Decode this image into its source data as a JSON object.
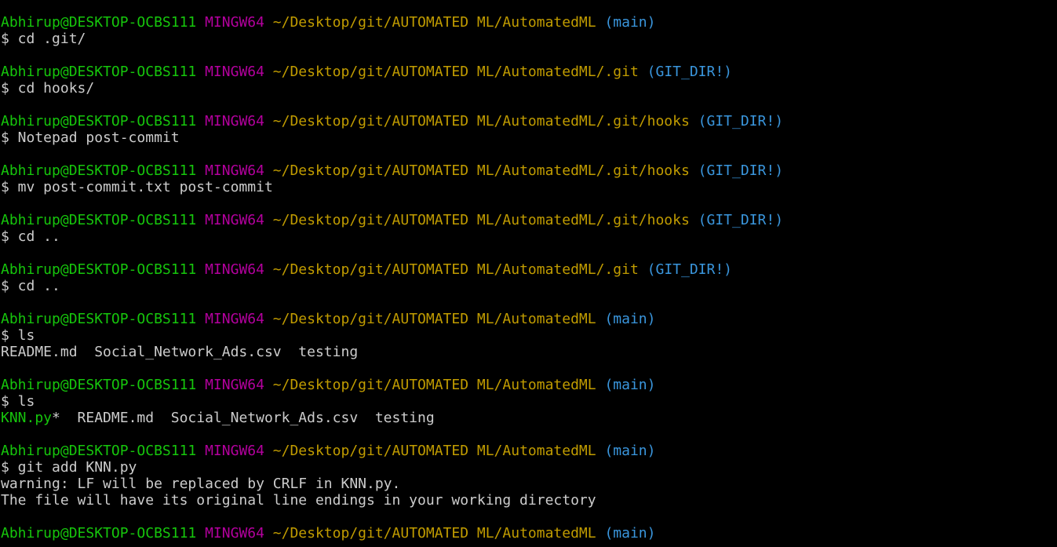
{
  "colors": {
    "background": "#000000",
    "user": "#16c60c",
    "mingw": "#b4009e",
    "path": "#c19c00",
    "branch": "#3a96dd",
    "text": "#cccccc",
    "executable": "#16c60c"
  },
  "blocks": [
    {
      "prompt": {
        "user": "Abhirup@DESKTOP-OCBS111",
        "env": "MINGW64",
        "path": "~/Desktop/git/AUTOMATED ML/AutomatedML",
        "branch": "(main)"
      },
      "command": "$ cd .git/",
      "output": []
    },
    {
      "prompt": {
        "user": "Abhirup@DESKTOP-OCBS111",
        "env": "MINGW64",
        "path": "~/Desktop/git/AUTOMATED ML/AutomatedML/.git",
        "branch": "(GIT_DIR!)"
      },
      "command": "$ cd hooks/",
      "output": []
    },
    {
      "prompt": {
        "user": "Abhirup@DESKTOP-OCBS111",
        "env": "MINGW64",
        "path": "~/Desktop/git/AUTOMATED ML/AutomatedML/.git/hooks",
        "branch": "(GIT_DIR!)"
      },
      "command": "$ Notepad post-commit",
      "output": []
    },
    {
      "prompt": {
        "user": "Abhirup@DESKTOP-OCBS111",
        "env": "MINGW64",
        "path": "~/Desktop/git/AUTOMATED ML/AutomatedML/.git/hooks",
        "branch": "(GIT_DIR!)"
      },
      "command": "$ mv post-commit.txt post-commit",
      "output": []
    },
    {
      "prompt": {
        "user": "Abhirup@DESKTOP-OCBS111",
        "env": "MINGW64",
        "path": "~/Desktop/git/AUTOMATED ML/AutomatedML/.git/hooks",
        "branch": "(GIT_DIR!)"
      },
      "command": "$ cd ..",
      "output": []
    },
    {
      "prompt": {
        "user": "Abhirup@DESKTOP-OCBS111",
        "env": "MINGW64",
        "path": "~/Desktop/git/AUTOMATED ML/AutomatedML/.git",
        "branch": "(GIT_DIR!)"
      },
      "command": "$ cd ..",
      "output": []
    },
    {
      "prompt": {
        "user": "Abhirup@DESKTOP-OCBS111",
        "env": "MINGW64",
        "path": "~/Desktop/git/AUTOMATED ML/AutomatedML",
        "branch": "(main)"
      },
      "command": "$ ls",
      "output": [
        {
          "segments": [
            {
              "text": "README.md  Social_Network_Ads.csv  testing",
              "kind": "plain"
            }
          ]
        }
      ]
    },
    {
      "prompt": {
        "user": "Abhirup@DESKTOP-OCBS111",
        "env": "MINGW64",
        "path": "~/Desktop/git/AUTOMATED ML/AutomatedML",
        "branch": "(main)"
      },
      "command": "$ ls",
      "output": [
        {
          "segments": [
            {
              "text": "KNN.py",
              "kind": "exe"
            },
            {
              "text": "*  README.md  Social_Network_Ads.csv  testing",
              "kind": "plain"
            }
          ]
        }
      ]
    },
    {
      "prompt": {
        "user": "Abhirup@DESKTOP-OCBS111",
        "env": "MINGW64",
        "path": "~/Desktop/git/AUTOMATED ML/AutomatedML",
        "branch": "(main)"
      },
      "command": "$ git add KNN.py",
      "output": [
        {
          "segments": [
            {
              "text": "warning: LF will be replaced by CRLF in KNN.py.",
              "kind": "plain"
            }
          ]
        },
        {
          "segments": [
            {
              "text": "The file will have its original line endings in your working directory",
              "kind": "plain"
            }
          ]
        }
      ]
    },
    {
      "prompt": {
        "user": "Abhirup@DESKTOP-OCBS111",
        "env": "MINGW64",
        "path": "~/Desktop/git/AUTOMATED ML/AutomatedML",
        "branch": "(main)"
      },
      "command": "",
      "output": []
    }
  ]
}
